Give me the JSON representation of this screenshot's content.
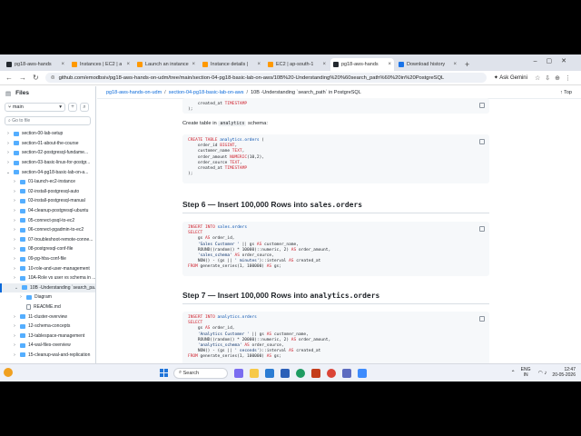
{
  "browser": {
    "tabs": [
      {
        "title": "pg18-aws-hands",
        "color": "#24292f",
        "active": false
      },
      {
        "title": "Instances | EC2 | a",
        "color": "#ff9900",
        "active": false
      },
      {
        "title": "Launch an instance",
        "color": "#ff9900",
        "active": false
      },
      {
        "title": "Instance details |",
        "color": "#ff9900",
        "active": false
      },
      {
        "title": "EC2 | ap-south-1",
        "color": "#ff9900",
        "active": false
      },
      {
        "title": "pg18-aws-hands",
        "color": "#24292f",
        "active": true
      },
      {
        "title": "Download history",
        "color": "#1a73e8",
        "active": false
      }
    ],
    "url": "github.com/emodbsiv/pg18-aws-hands-on-udm/tree/main/section-04-pg18-basic-lab-on-aws/10B%20-Understanding%20%60search_path%60%20in%20PostgreSQL",
    "ask_gemini": "Ask Gemini"
  },
  "sidebar": {
    "title": "Files",
    "branch": "main",
    "goto_placeholder": "Go to file",
    "items": [
      {
        "label": "section-00-lab-setup",
        "type": "folder",
        "indent": 0,
        "chev": "›",
        "selected": false
      },
      {
        "label": "section-01-about-the-course",
        "type": "folder",
        "indent": 0,
        "chev": "›",
        "selected": false
      },
      {
        "label": "section-02-postgresql-fundame...",
        "type": "folder",
        "indent": 0,
        "chev": "›",
        "selected": false
      },
      {
        "label": "section-03-basic-linux-for-postgr...",
        "type": "folder",
        "indent": 0,
        "chev": "›",
        "selected": false
      },
      {
        "label": "section-04-pg18-basic-lab-on-a...",
        "type": "folder",
        "indent": 0,
        "chev": "⌄",
        "selected": false
      },
      {
        "label": "01-launch-ec2-instance",
        "type": "folder",
        "indent": 1,
        "chev": "›",
        "selected": false
      },
      {
        "label": "02-install-postgresql-auto",
        "type": "folder",
        "indent": 1,
        "chev": "›",
        "selected": false
      },
      {
        "label": "03-install-postgresql-manual",
        "type": "folder",
        "indent": 1,
        "chev": "›",
        "selected": false
      },
      {
        "label": "04-cleanup-postgresql-ubuntu",
        "type": "folder",
        "indent": 1,
        "chev": "›",
        "selected": false
      },
      {
        "label": "05-connect-psql-to-ec2",
        "type": "folder",
        "indent": 1,
        "chev": "›",
        "selected": false
      },
      {
        "label": "06-connect-pgadmin-to-ec2",
        "type": "folder",
        "indent": 1,
        "chev": "›",
        "selected": false
      },
      {
        "label": "07-troubleshoot-remote-conne...",
        "type": "folder",
        "indent": 1,
        "chev": "›",
        "selected": false
      },
      {
        "label": "08-postgresql-conf-file",
        "type": "folder",
        "indent": 1,
        "chev": "›",
        "selected": false
      },
      {
        "label": "09-pg-hba-conf-file",
        "type": "folder",
        "indent": 1,
        "chev": "›",
        "selected": false
      },
      {
        "label": "10-role-and-user-management",
        "type": "folder",
        "indent": 1,
        "chev": "›",
        "selected": false
      },
      {
        "label": "10A-Role vs user vs schema in ...",
        "type": "folder",
        "indent": 1,
        "chev": "›",
        "selected": false
      },
      {
        "label": "10B -Understanding `search_pa...",
        "type": "folder",
        "indent": 1,
        "chev": "⌄",
        "selected": true
      },
      {
        "label": "Diagram",
        "type": "folder",
        "indent": 2,
        "chev": "›",
        "selected": false
      },
      {
        "label": "README.md",
        "type": "file",
        "indent": 2,
        "chev": "",
        "selected": false
      },
      {
        "label": "11-cluster-overview",
        "type": "folder",
        "indent": 1,
        "chev": "›",
        "selected": false
      },
      {
        "label": "12-schema-concepts",
        "type": "folder",
        "indent": 1,
        "chev": "›",
        "selected": false
      },
      {
        "label": "13-tablespace-management",
        "type": "folder",
        "indent": 1,
        "chev": "›",
        "selected": false
      },
      {
        "label": "14-wal-files-overview",
        "type": "folder",
        "indent": 1,
        "chev": "›",
        "selected": false
      },
      {
        "label": "15-cleanup-wal-and-replication",
        "type": "folder",
        "indent": 1,
        "chev": "›",
        "selected": false
      }
    ]
  },
  "breadcrumb": {
    "repo": "pg18-aws-hands-on-udm",
    "section": "section-04-pg18-basic-lab-on-aws",
    "current": "10B -Understanding `search_path` in PostgreSQL",
    "top_label": "Top"
  },
  "doc": {
    "code0_lines": [
      "    created_at TIMESTAMP",
      ");"
    ],
    "para1_prefix": "Create table in",
    "para1_code": "analytics",
    "para1_suffix": "schema:",
    "code1_lines": [
      "CREATE TABLE analytics.orders (",
      "    order_id BIGINT,",
      "    customer_name TEXT,",
      "    order_amount NUMERIC(10,2),",
      "    order_source TEXT,",
      "    created_at TIMESTAMP",
      ");"
    ],
    "step6_prefix": "Step 6 — Insert 100,000 Rows into",
    "step6_code": "sales.orders",
    "code2_lines": [
      "INSERT INTO sales.orders",
      "SELECT",
      "    gs AS order_id,",
      "    'Sales Customer ' || gs AS customer_name,",
      "    ROUND((random() * 10000)::numeric, 2) AS order_amount,",
      "    'sales_schema' AS order_source,",
      "    NOW() - (gs || ' minutes')::interval AS created_at",
      "FROM generate_series(1, 100000) AS gs;"
    ],
    "step7_prefix": "Step 7 — Insert 100,000 Rows into",
    "step7_code": "analytics.orders",
    "code3_lines": [
      "INSERT INTO analytics.orders",
      "SELECT",
      "    gs AS order_id,",
      "    'Analytics Customer ' || gs AS customer_name,",
      "    ROUND((random() * 20000)::numeric, 2) AS order_amount,",
      "    'analytics_schema' AS order_source,",
      "    NOW() - (gs || ' seconds')::interval AS created_at",
      "FROM generate_series(1, 100000) AS gs;"
    ]
  },
  "taskbar": {
    "search": "Search",
    "lang1": "ENG",
    "lang2": "IN",
    "time": "12:47",
    "date": "20-05-2026"
  }
}
